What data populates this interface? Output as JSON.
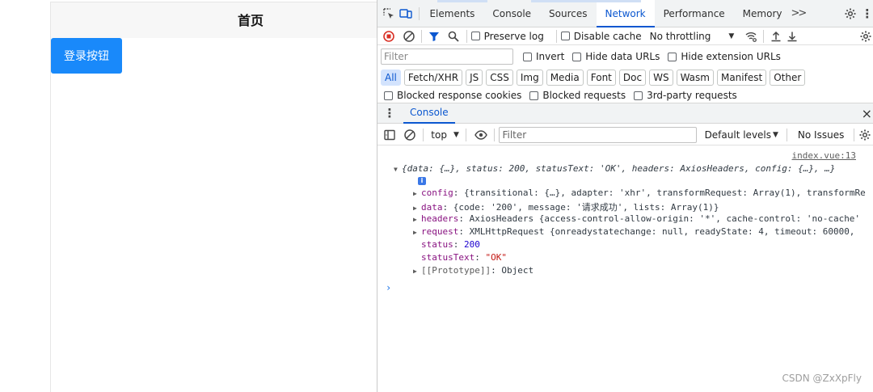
{
  "app": {
    "title": "首页",
    "login_button": "登录按钮"
  },
  "devtools": {
    "tabs": [
      "Elements",
      "Console",
      "Sources",
      "Network",
      "Performance",
      "Memory"
    ],
    "active_tab": "Network",
    "more_tabs_icon": ">>",
    "network_toolbar": {
      "preserve_log": "Preserve log",
      "disable_cache": "Disable cache",
      "throttling": "No throttling"
    },
    "filter": {
      "placeholder": "Filter",
      "invert": "Invert",
      "hide_data_urls": "Hide data URLs",
      "hide_extension_urls": "Hide extension URLs"
    },
    "types": [
      "All",
      "Fetch/XHR",
      "JS",
      "CSS",
      "Img",
      "Media",
      "Font",
      "Doc",
      "WS",
      "Wasm",
      "Manifest",
      "Other"
    ],
    "blocked": {
      "response_cookies": "Blocked response cookies",
      "requests": "Blocked requests",
      "third_party": "3rd-party requests"
    },
    "drawer": {
      "tab": "Console",
      "close": "×"
    },
    "console_toolbar": {
      "context": "top",
      "filter_placeholder": "Filter",
      "levels": "Default levels",
      "issues": "No Issues"
    },
    "console": {
      "source": "index.vue:13",
      "summary": "{data: {…}, status: 200, statusText: 'OK', headers: AxiosHeaders, config: {…}, …}",
      "info_badge": "i",
      "config_key": "config",
      "config_val": "{transitional: {…}, adapter: 'xhr', transformRequest: Array(1), transformRe",
      "data_key": "data",
      "data_val": "{code: '200', message: '请求成功', lists: Array(1)}",
      "headers_key": "headers",
      "headers_val": "AxiosHeaders {access-control-allow-origin: '*', cache-control: 'no-cache'",
      "request_key": "request",
      "request_val": "XMLHttpRequest {onreadystatechange: null, readyState: 4, timeout: 60000, ",
      "status_key": "status",
      "status_val": "200",
      "statustext_key": "statusText",
      "statustext_val": "\"OK\"",
      "proto_key": "[[Prototype]]",
      "proto_val": "Object",
      "prompt": "›"
    }
  },
  "watermark": "CSDN @ZxXpFly"
}
